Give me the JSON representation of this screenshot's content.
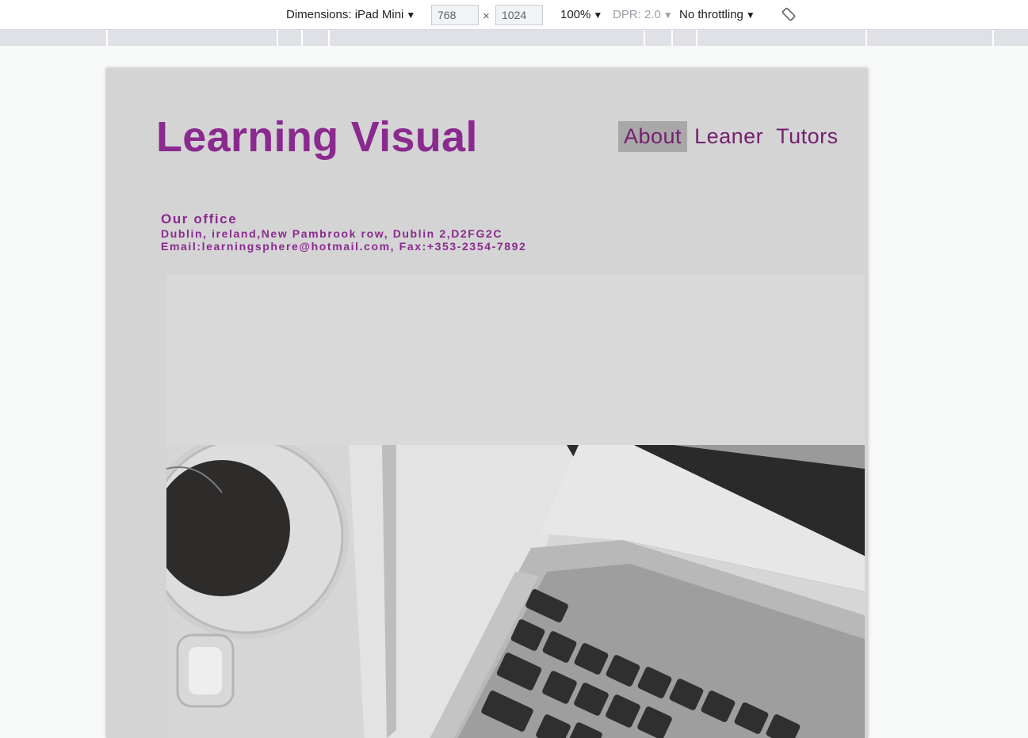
{
  "devtools": {
    "dimensions_label": "Dimensions: iPad Mini",
    "width_value": "768",
    "height_value": "1024",
    "times": "×",
    "zoom": "100%",
    "dpr": "DPR: 2.0",
    "throttling": "No throttling",
    "caret": "▼",
    "rotate_icon": "rotate-icon"
  },
  "site": {
    "brand": "Learning Visual",
    "nav": [
      {
        "label": "About",
        "active": true
      },
      {
        "label": "Leaner",
        "active": false
      },
      {
        "label": "Tutors",
        "active": false
      }
    ],
    "office": {
      "heading": "Our office",
      "address": "Dublin, ireland,New Pambrook row, Dublin 2,D2FG2C",
      "contact": "Email:learningsphere@hotmail.com, Fax:+353-2354-7892"
    },
    "hero_image": "desk-with-coffee-and-laptop"
  },
  "colors": {
    "brand": "#8a2a8e",
    "nav_text": "#74206f",
    "nav_active_bg": "#a9a8a9",
    "page_bg": "#d4d4d5"
  }
}
